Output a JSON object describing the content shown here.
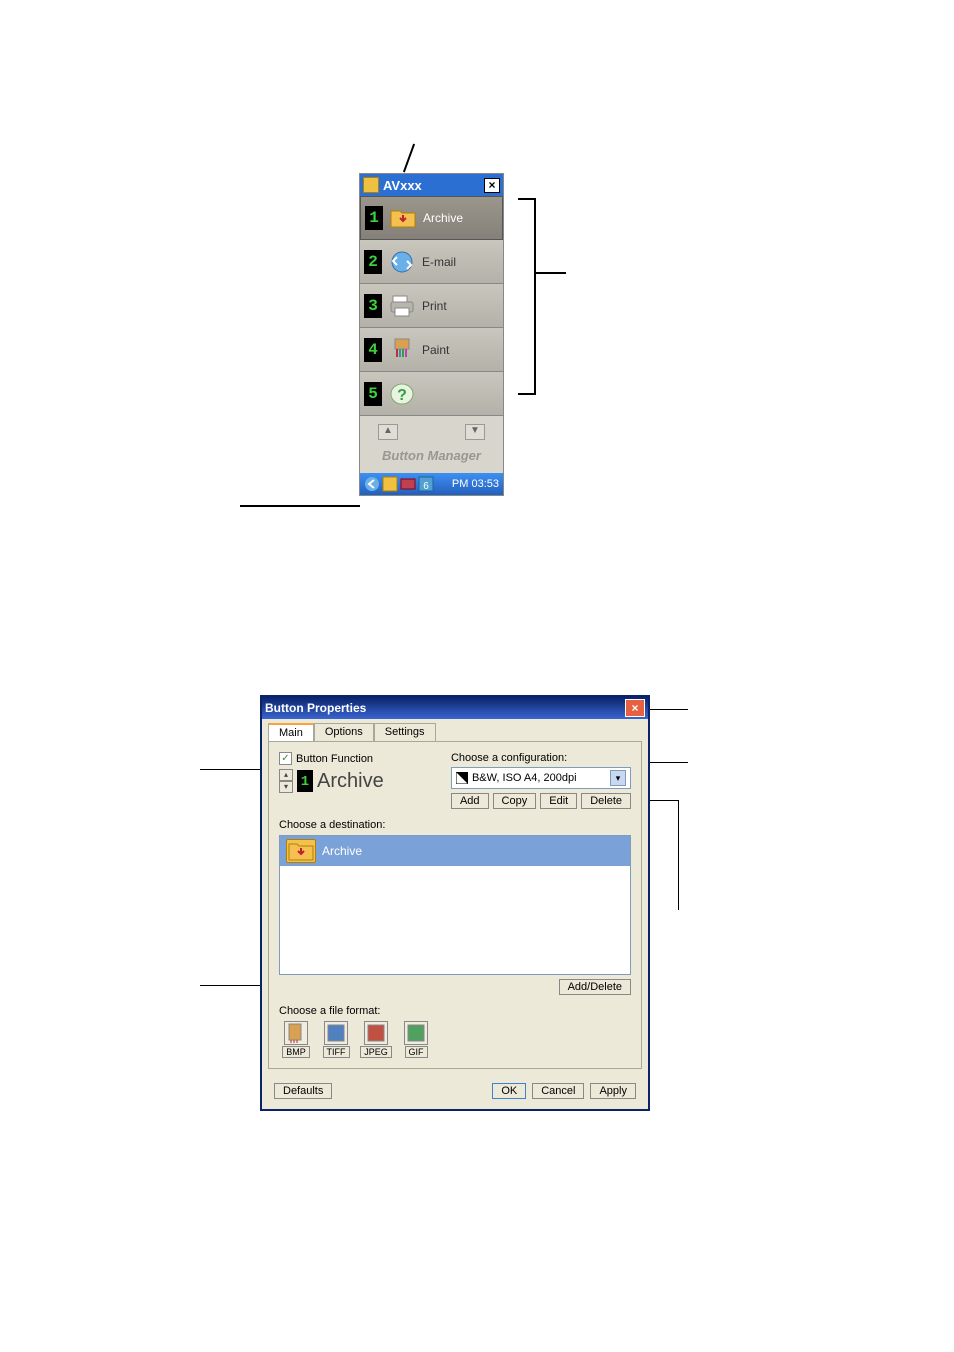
{
  "panel1": {
    "title": "AVxxx",
    "buttons": [
      {
        "num": "1",
        "label": "Archive",
        "icon": "folder-down"
      },
      {
        "num": "2",
        "label": "E-mail",
        "icon": "mail"
      },
      {
        "num": "3",
        "label": "Print",
        "icon": "printer"
      },
      {
        "num": "4",
        "label": "Paint",
        "icon": "brush"
      },
      {
        "num": "5",
        "label": "",
        "icon": "help"
      }
    ],
    "footer_label": "Button Manager",
    "time": "PM 03:53"
  },
  "dialog": {
    "title": "Button Properties",
    "tabs": [
      "Main",
      "Options",
      "Settings"
    ],
    "button_function_label": "Button Function",
    "function_name": "Archive",
    "config_label": "Choose a configuration:",
    "config_value": "B&W, ISO A4, 200dpi",
    "config_buttons": [
      "Add",
      "Copy",
      "Edit",
      "Delete"
    ],
    "dest_label": "Choose a destination:",
    "dest_item": "Archive",
    "add_delete": "Add/Delete",
    "format_label": "Choose a file format:",
    "formats": [
      "BMP",
      "TIFF",
      "JPEG",
      "GIF"
    ],
    "footer_buttons": [
      "Defaults",
      "OK",
      "Cancel",
      "Apply"
    ]
  }
}
